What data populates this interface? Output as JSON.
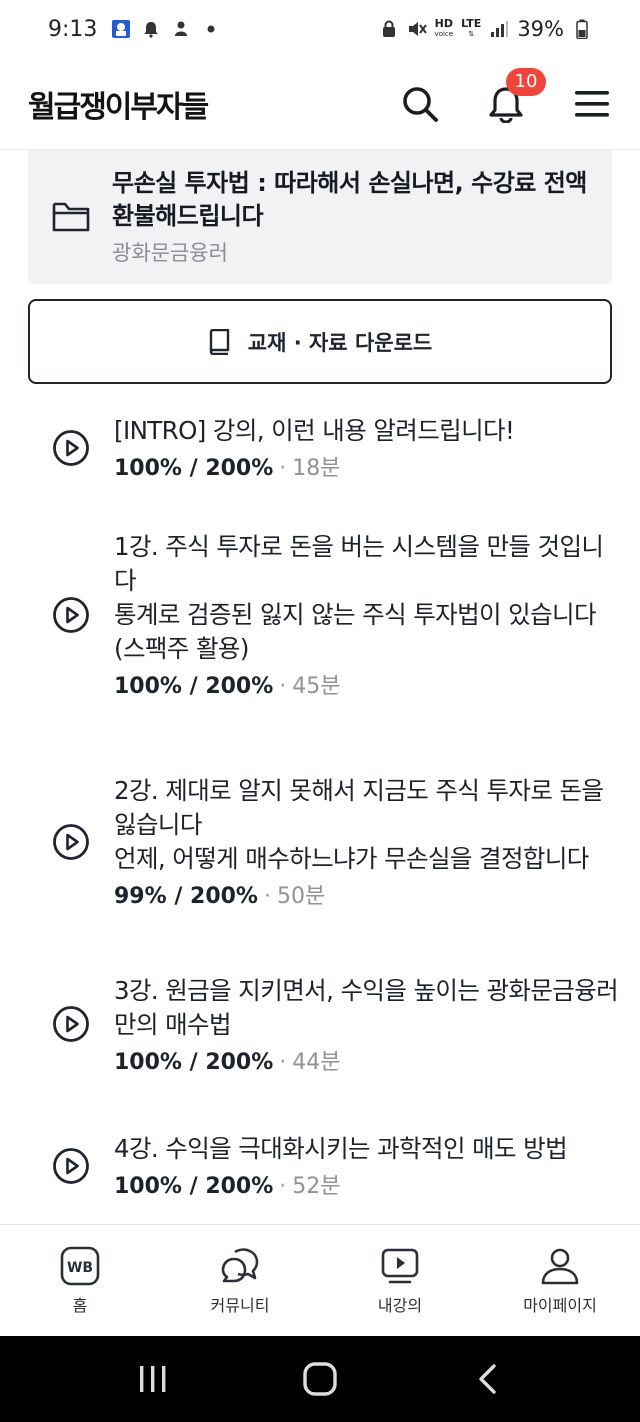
{
  "status_bar": {
    "time": "9:13",
    "battery": "39%",
    "network": "LTE",
    "hd_label": "HD",
    "voice_label": "voice"
  },
  "header": {
    "logo": "월급쟁이부자들",
    "notification_count": "10"
  },
  "course": {
    "title": "무손실 투자법 : 따라해서 손실나면, 수강료 전액 환불해드립니다",
    "instructor": "광화문금융러"
  },
  "download": {
    "label": "교재 · 자료 다운로드"
  },
  "lectures": [
    {
      "title": "[INTRO] 강의, 이런 내용 알려드립니다!",
      "progress": "100% / 200%",
      "separator": "·",
      "duration": "18분"
    },
    {
      "title": "1강. 주식 투자로 돈을 버는 시스템을 만들 것입니다\n통계로 검증된 잃지 않는 주식 투자법이 있습니다 (스팩주 활용)",
      "progress": "100% / 200%",
      "separator": "·",
      "duration": "45분"
    },
    {
      "title": "2강. 제대로 알지 못해서 지금도 주식 투자로 돈을 잃습니다\n언제, 어떻게 매수하느냐가 무손실을 결정합니다",
      "progress": "99% / 200%",
      "separator": "·",
      "duration": "50분"
    },
    {
      "title": "3강. 원금을 지키면서, 수익을 높이는 광화문금융러만의 매수법",
      "progress": "100% / 200%",
      "separator": "·",
      "duration": "44분"
    },
    {
      "title": "4강. 수익을 극대화시키는 과학적인 매도 방법",
      "progress": "100% / 200%",
      "separator": "·",
      "duration": "52분"
    }
  ],
  "tabs": [
    {
      "label": "홈",
      "icon": "wb-home-icon",
      "logo_text": "WB"
    },
    {
      "label": "커뮤니티",
      "icon": "chat-bubbles-icon"
    },
    {
      "label": "내강의",
      "icon": "my-lecture-icon"
    },
    {
      "label": "마이페이지",
      "icon": "person-icon"
    }
  ],
  "colors": {
    "badge": "#f0453a",
    "text_primary": "#1f2430",
    "card_bg": "#f2f2f4"
  }
}
